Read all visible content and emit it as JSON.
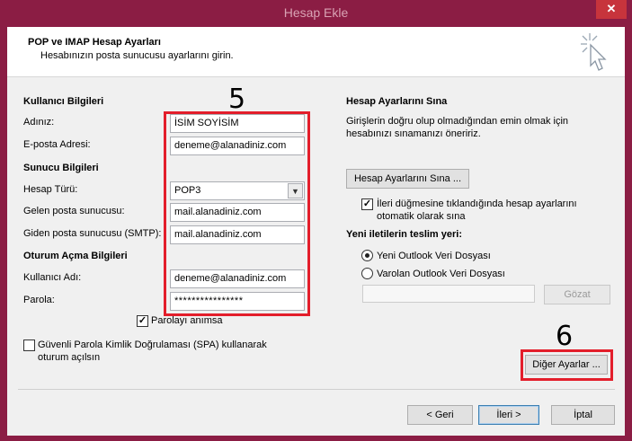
{
  "window": {
    "title": "Hesap Ekle",
    "close_glyph": "✕",
    "icon": "wizard-cursor-icon"
  },
  "header": {
    "title": "POP ve IMAP Hesap Ayarları",
    "subtitle": "Hesabınızın posta sunucusu ayarlarını girin."
  },
  "annotations": {
    "step_5": "5",
    "step_6": "6",
    "highlight_color": "#e31e2b"
  },
  "user_info": {
    "section": "Kullanıcı Bilgileri",
    "name_label": "Adınız:",
    "name_value": "İSİM SOYİSİM",
    "email_label": "E-posta Adresi:",
    "email_value": "deneme@alanadiniz.com"
  },
  "server_info": {
    "section": "Sunucu Bilgileri",
    "account_type_label": "Hesap Türü:",
    "account_type_value": "POP3",
    "incoming_label": "Gelen posta sunucusu:",
    "incoming_value": "mail.alanadiniz.com",
    "outgoing_label": "Giden posta sunucusu (SMTP):",
    "outgoing_value": "mail.alanadiniz.com"
  },
  "logon_info": {
    "section": "Oturum Açma Bilgileri",
    "username_label": "Kullanıcı Adı:",
    "username_value": "deneme@alanadiniz.com",
    "password_label": "Parola:",
    "password_value": "****************",
    "remember_label": "Parolayı anımsa",
    "remember_checked": true,
    "spa_label_line1": "Güvenli Parola Kimlik Doğrulaması (SPA) kullanarak",
    "spa_label_line2": "oturum açılsın",
    "spa_checked": false
  },
  "test_settings": {
    "section": "Hesap Ayarlarını Sına",
    "description_line1": "Girişlerin doğru olup olmadığından emin olmak için",
    "description_line2": "hesabınızı sınamanızı öneririz.",
    "test_button": "Hesap Ayarlarını Sına ...",
    "auto_test_line1": "İleri düğmesine tıklandığında hesap ayarlarını",
    "auto_test_line2": "otomatik olarak sına",
    "auto_test_checked": true
  },
  "delivery": {
    "section": "Yeni iletilerin teslim yeri:",
    "new_file_label": "Yeni Outlook Veri Dosyası",
    "existing_file_label": "Varolan Outlook Veri Dosyası",
    "selected": "new",
    "browse_button": "Gözat",
    "path_value": ""
  },
  "buttons": {
    "more_settings": "Diğer Ayarlar ...",
    "back": "< Geri",
    "next": "İleri >",
    "cancel": "İptal"
  }
}
